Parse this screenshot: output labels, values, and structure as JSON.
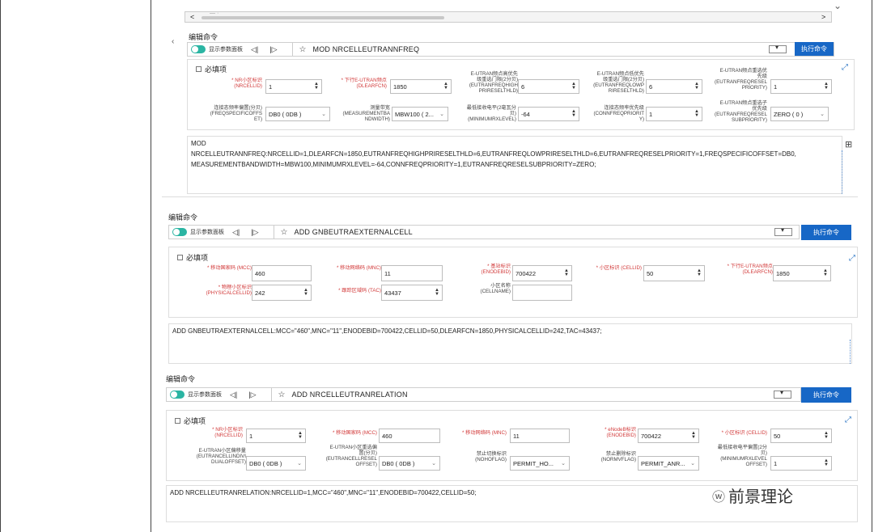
{
  "top": {
    "scroll_text": "— ·",
    "left_arrow": "<",
    "right_arrow": ">",
    "collapse_arrow": "‹",
    "down_chev": "⌄"
  },
  "panels": [
    {
      "section_title": "编辑命令",
      "toolbar": {
        "show_panel": "显示参数面板",
        "command": "MOD NRCELLEUTRANNFREQ",
        "exec": "执行命令"
      },
      "required": "必填项",
      "fields": [
        {
          "label": "* NR小区标识\n(NRCELLID)",
          "value": "1",
          "kind": "spin",
          "red": true
        },
        {
          "label": "* 下行E-UTRAN频点\n(DLEARFCN)",
          "value": "1850",
          "kind": "spin",
          "red": true
        },
        {
          "label": "E-UTRAN频点高优先\n级重选门限(2分贝)\n(EUTRANFREQHIGH\nPRIRESELTHLD)",
          "value": "6",
          "kind": "spin",
          "red": false
        },
        {
          "label": "E-UTRAN频点低优先\n级重选门限(2分贝)\n(EUTRANFREQLOWP\nRIRESELTHLD)",
          "value": "6",
          "kind": "spin",
          "red": false
        },
        {
          "label": "E-UTRAN频点重选优\n先级\n(EUTRANFREQRESEL\nPRIORITY)",
          "value": "1",
          "kind": "spin",
          "red": false
        },
        {
          "label": "连接态频率偏置(分贝)\n(FREQSPECIFICOFFS\nET)",
          "value": "DB0 ( 0DB )",
          "kind": "select",
          "red": false
        },
        {
          "label": "测量带宽\n(MEASUREMENTBA\nNDWIDTH)",
          "value": "MBW100 ( 2...",
          "kind": "select",
          "red": false
        },
        {
          "label": "最低接收电平(2毫瓦分\n贝)\n(MINIMUMRXLEVEL)",
          "value": "-64",
          "kind": "spin",
          "red": false
        },
        {
          "label": "连接态频率优先级\n(CONNFREQPRIORIT\nY)",
          "value": "1",
          "kind": "spin",
          "red": false
        },
        {
          "label": "E-UTRAN频点重选子\n优先级\n(EUTRANFREQRESEL\nSUBPRIORITY)",
          "value": "ZERO ( 0 )",
          "kind": "select",
          "red": false
        }
      ],
      "command_text": [
        "MOD",
        "NRCELLEUTRANNFREQ:NRCELLID=1,DLEARFCN=1850,EUTRANFREQHIGHPRIRESELTHLD=6,EUTRANFREQLOWPRIRESELTHLD=6,EUTRANFREQRESELPRIORITY=1,FREQSPECIFICOFFSET=DB0,",
        "MEASUREMENTBANDWIDTH=MBW100,MINIMUMRXLEVEL=-64,CONNFREQPRIORITY=1,EUTRANFREQRESELSUBPRIORITY=ZERO;"
      ]
    },
    {
      "section_title": "编辑命令",
      "toolbar": {
        "show_panel": "显示参数面板",
        "command": "ADD GNBEUTRAEXTERNALCELL",
        "exec": "执行命令"
      },
      "required": "必填项",
      "fields": [
        {
          "label": "* 移动国家码 (MCC)",
          "value": "460",
          "kind": "text",
          "red": true
        },
        {
          "label": "* 移动网络码 (MNC)",
          "value": "11",
          "kind": "text",
          "red": true
        },
        {
          "label": "* 基站标识\n(ENODEBID)",
          "value": "700422",
          "kind": "spin",
          "red": true
        },
        {
          "label": "* 小区标识 (CELLID)",
          "value": "50",
          "kind": "spin",
          "red": true
        },
        {
          "label": "* 下行E-UTRAN频点\n(DLEARFCN)",
          "value": "1850",
          "kind": "spin",
          "red": true
        },
        {
          "label": "* 物理小区标识\n(PHYSICALCELLID)",
          "value": "242",
          "kind": "spin",
          "red": true
        },
        {
          "label": "* 跟踪区域码 (TAC)",
          "value": "43437",
          "kind": "spin",
          "red": true
        },
        {
          "label": "小区名称\n(CELLNAME)",
          "value": "",
          "kind": "text",
          "red": false
        }
      ],
      "command_text": [
        "ADD GNBEUTRAEXTERNALCELL:MCC=\"460\",MNC=\"11\",ENODEBID=700422,CELLID=50,DLEARFCN=1850,PHYSICALCELLID=242,TAC=43437;"
      ]
    },
    {
      "section_title": "编辑命令",
      "toolbar": {
        "show_panel": "显示参数面板",
        "command": "ADD NRCELLEUTRANRELATION",
        "exec": "执行命令"
      },
      "required": "必填项",
      "fields": [
        {
          "label": "* NR小区标识\n(NRCELLID)",
          "value": "1",
          "kind": "spin",
          "red": true
        },
        {
          "label": "* 移动国家码 (MCC)",
          "value": "460",
          "kind": "text",
          "red": true
        },
        {
          "label": "* 移动网络码 (MNC)",
          "value": "11",
          "kind": "text",
          "red": true
        },
        {
          "label": "* eNodeB标识\n(ENODEBID)",
          "value": "700422",
          "kind": "spin",
          "red": true
        },
        {
          "label": "* 小区标识 (CELLID)",
          "value": "50",
          "kind": "spin",
          "red": true
        },
        {
          "label": "E-UTRAN小区偏移量\n(EUTRANCELLINDIVI\nDUALOFFSET)",
          "value": "DB0 ( 0DB )",
          "kind": "select",
          "red": false
        },
        {
          "label": "E-UTRAN小区重选偏\n置(分贝)\n(EUTRANCELLRESEL\nOFFSET)",
          "value": "DB0 ( 0DB )",
          "kind": "select",
          "red": false
        },
        {
          "label": "禁止切换标识\n(NOHOFLAG)",
          "value": "PERMIT_HO...",
          "kind": "select",
          "red": false
        },
        {
          "label": "禁止删除标识\n(NORMVFLAG)",
          "value": "PERMIT_ANR...",
          "kind": "select",
          "red": false
        },
        {
          "label": "最低接收电平偏置(2分\n贝)\n(MINIMUMRXLEVEL\nOFFSET)",
          "value": "1",
          "kind": "spin",
          "red": false
        }
      ],
      "command_text": [
        "ADD NRCELLEUTRANRELATION:NRCELLID=1,MCC=\"460\",MNC=\"11\",ENODEBID=700422,CELLID=50;"
      ]
    }
  ],
  "watermark": {
    "logo": "ⓦ",
    "text": "前景理论"
  },
  "icons": {
    "toggle": "toggle-switch",
    "prev": "prev-icon",
    "next": "next-icon",
    "star": "star-icon",
    "expand": "expand-icon"
  },
  "colors": {
    "accent": "#1767c6",
    "toggle": "#2bb5a3",
    "required": "#d23a3a"
  }
}
